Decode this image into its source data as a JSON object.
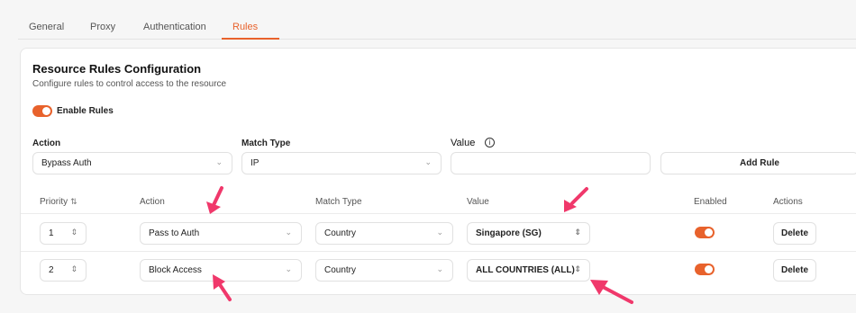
{
  "tabs": [
    {
      "label": "General",
      "active": false
    },
    {
      "label": "Proxy",
      "active": false
    },
    {
      "label": "Authentication",
      "active": false
    },
    {
      "label": "Rules",
      "active": true
    }
  ],
  "card": {
    "title": "Resource Rules Configuration",
    "subtitle": "Configure rules to control access to the resource",
    "enable_label": "Enable Rules"
  },
  "form": {
    "action_label": "Action",
    "action_value": "Bypass Auth",
    "match_type_label": "Match Type",
    "match_type_value": "IP",
    "value_label": "Value",
    "value_value": "",
    "add_rule": "Add Rule"
  },
  "table": {
    "headers": [
      "Priority",
      "Action",
      "Match Type",
      "Value",
      "Enabled",
      "Actions"
    ],
    "rows": [
      {
        "priority": "1",
        "action": "Pass to Auth",
        "match_type": "Country",
        "value": "Singapore (SG)",
        "enabled": true,
        "delete": "Delete"
      },
      {
        "priority": "2",
        "action": "Block Access",
        "match_type": "Country",
        "value": "ALL COUNTRIES (ALL)",
        "enabled": true,
        "delete": "Delete"
      }
    ]
  },
  "colors": {
    "accent": "#e8622c",
    "annotation_arrow": "#f0386b"
  }
}
